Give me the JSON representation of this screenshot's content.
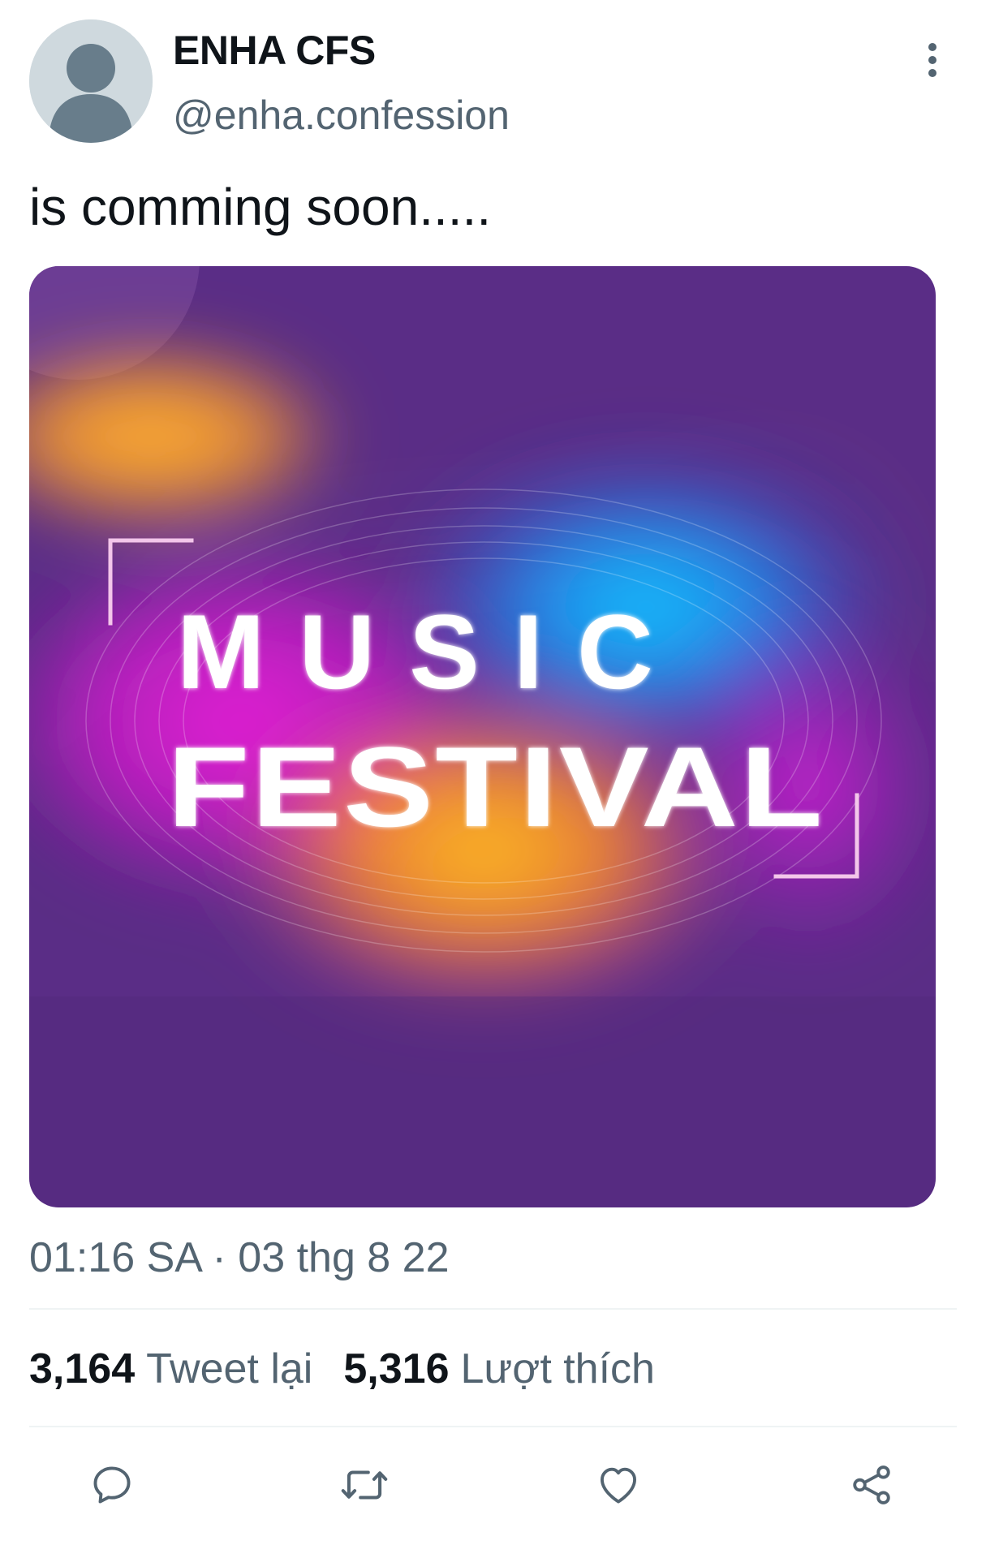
{
  "author": {
    "display_name": "ENHA CFS",
    "handle": "@enha.confession"
  },
  "tweet": {
    "text": "is comming soon.....",
    "timestamp": "01:16 SA · 03 thg 8 22"
  },
  "media": {
    "line1": "MUSIC",
    "line2": "FESTIVAL"
  },
  "stats": {
    "retweets_count": "3,164",
    "retweets_label": "Tweet lại",
    "likes_count": "5,316",
    "likes_label": "Lượt thích"
  },
  "icons": {
    "more": "more-vertical-icon",
    "reply": "reply-icon",
    "retweet": "retweet-icon",
    "like": "heart-icon",
    "share": "share-icon"
  },
  "colors": {
    "text_primary": "#0f1419",
    "text_secondary": "#536471",
    "divider": "#eff3f4",
    "avatar_bg": "#cfd9de",
    "media_bg": "#5a2d86"
  }
}
